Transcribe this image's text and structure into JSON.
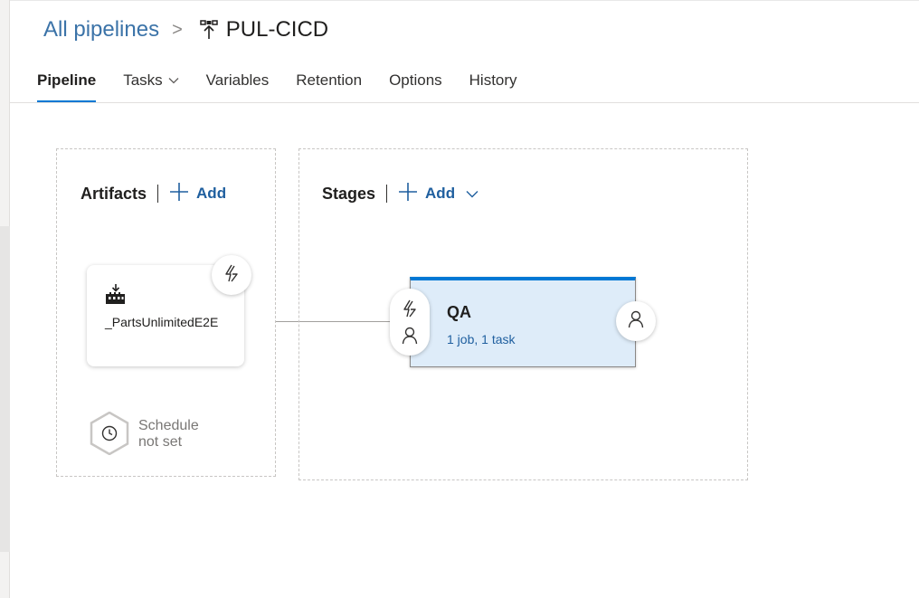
{
  "breadcrumb": {
    "root_label": "All pipelines",
    "separator": ">",
    "pipeline_name": "PUL-CICD"
  },
  "tabs": [
    {
      "label": "Pipeline",
      "active": true
    },
    {
      "label": "Tasks",
      "has_dropdown": true
    },
    {
      "label": "Variables"
    },
    {
      "label": "Retention"
    },
    {
      "label": "Options"
    },
    {
      "label": "History"
    }
  ],
  "artifacts": {
    "title": "Artifacts",
    "add_label": "Add",
    "items": [
      {
        "name": "_PartsUnlimitedE2E",
        "icon": "build-artifact-icon"
      }
    ],
    "trigger_icon": "lightning-icon",
    "schedule": {
      "line1": "Schedule",
      "line2": "not set",
      "icon": "clock-icon"
    }
  },
  "stages": {
    "title": "Stages",
    "add_label": "Add",
    "items": [
      {
        "name": "QA",
        "summary": "1 job, 1 task",
        "pre_icons": [
          "lightning-icon",
          "person-icon"
        ],
        "post_icon": "person-icon"
      }
    ]
  },
  "colors": {
    "accent": "#0078d4",
    "link": "#1f5f9f",
    "stage_fill": "#deecf9"
  }
}
